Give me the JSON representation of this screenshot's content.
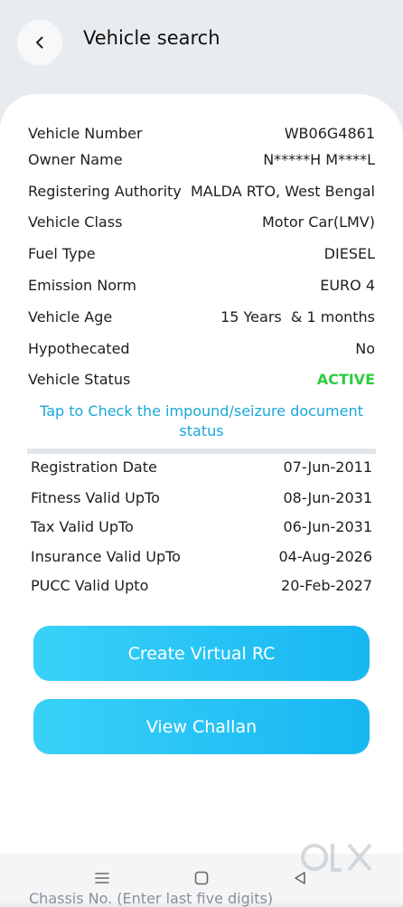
{
  "header": {
    "title": "Vehicle search"
  },
  "details": [
    {
      "label": "Vehicle Number",
      "value": "WB06G4861"
    },
    {
      "label": "Owner Name",
      "value": "N*****H M****L"
    },
    {
      "label": "Registering Authority",
      "value": "MALDA RTO, West Bengal"
    },
    {
      "label": "Vehicle Class",
      "value": "Motor Car(LMV)"
    },
    {
      "label": "Fuel Type",
      "value": "DIESEL"
    },
    {
      "label": "Emission Norm",
      "value": "EURO 4"
    },
    {
      "label": "Vehicle Age",
      "value": "15 Years  & 1 months"
    },
    {
      "label": "Hypothecated",
      "value": "No"
    },
    {
      "label": "Vehicle Status",
      "value": "ACTIVE"
    }
  ],
  "impound_link": "Tap to Check the impound/seizure document status",
  "validity": [
    {
      "label": "Registration Date",
      "value": "07-Jun-2011"
    },
    {
      "label": "Fitness Valid UpTo",
      "value": "08-Jun-2031"
    },
    {
      "label": "Tax Valid UpTo",
      "value": "06-Jun-2031"
    },
    {
      "label": "Insurance Valid UpTo",
      "value": "04-Aug-2026"
    },
    {
      "label": "PUCC Valid Upto",
      "value": "20-Feb-2027"
    }
  ],
  "buttons": {
    "virtual_rc": "Create Virtual RC",
    "challan": "View Challan"
  },
  "peek_text": "Chassis No. (Enter last five digits)",
  "watermark": "OLX",
  "colors": {
    "accent": "#1aa6d9",
    "status_active": "#2ecc40",
    "button": "#17b7f3"
  }
}
